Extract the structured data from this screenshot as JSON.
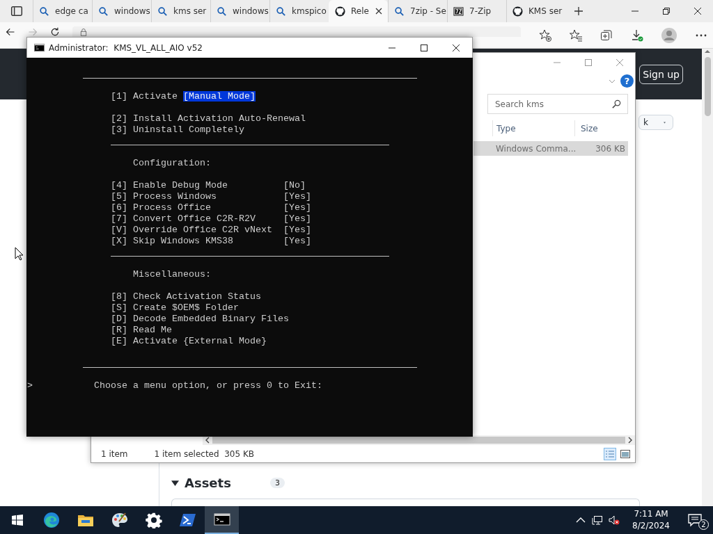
{
  "browser": {
    "tabs": [
      {
        "title": "edge ca",
        "kind": "search",
        "selected": false
      },
      {
        "title": "windows",
        "kind": "search",
        "selected": false
      },
      {
        "title": "kms ser",
        "kind": "search",
        "selected": false
      },
      {
        "title": "windows",
        "kind": "search",
        "selected": false
      },
      {
        "title": "kmspico",
        "kind": "search",
        "selected": false
      },
      {
        "title": "Rele",
        "kind": "github",
        "selected": true
      },
      {
        "title": "7zip - Se",
        "kind": "search",
        "selected": false
      },
      {
        "title": "7-Zip",
        "kind": "archive",
        "selected": false
      },
      {
        "title": "KMS ser",
        "kind": "github",
        "selected": false
      }
    ],
    "page": {
      "sign_up": "Sign up",
      "dropdown": "k",
      "assets": {
        "heading": "Assets",
        "count": "3",
        "expanded": true
      }
    }
  },
  "explorer": {
    "help": "?",
    "search": {
      "placeholder": "Search kms"
    },
    "columns": [
      "Type",
      "Size"
    ],
    "rows": [
      {
        "type": "Windows Comma...",
        "size": "306 KB",
        "selected": true
      }
    ],
    "status": {
      "items": "1 item",
      "selection": "1 item selected  305 KB"
    },
    "views": [
      {
        "kind": "details",
        "selected": true
      },
      {
        "kind": "preview",
        "selected": false
      }
    ]
  },
  "console": {
    "title": "Administrator:  KMS_VL_ALL_AIO v52",
    "lines": [
      {
        "kind": "blank"
      },
      {
        "kind": "rule"
      },
      {
        "kind": "blank"
      },
      {
        "kind": "option",
        "key": "[1]",
        "label": "Activate",
        "tag": "[Manual Mode]",
        "highlighted": true
      },
      {
        "kind": "blank"
      },
      {
        "kind": "option",
        "key": "[2]",
        "label": "Install Activation Auto-Renewal"
      },
      {
        "kind": "option",
        "key": "[3]",
        "label": "Uninstall Completely"
      },
      {
        "kind": "subrule"
      },
      {
        "kind": "blank"
      },
      {
        "kind": "heading",
        "text": "Configuration:"
      },
      {
        "kind": "blank"
      },
      {
        "kind": "option",
        "key": "[4]",
        "label": "Enable Debug Mode",
        "value": "[No]"
      },
      {
        "kind": "option",
        "key": "[5]",
        "label": "Process Windows",
        "value": "[Yes]"
      },
      {
        "kind": "option",
        "key": "[6]",
        "label": "Process Office",
        "value": "[Yes]"
      },
      {
        "kind": "option",
        "key": "[7]",
        "label": "Convert Office C2R-R2V",
        "value": "[Yes]"
      },
      {
        "kind": "option",
        "key": "[V]",
        "label": "Override Office C2R vNext",
        "value": "[Yes]"
      },
      {
        "kind": "option",
        "key": "[X]",
        "label": "Skip Windows KMS38",
        "value": "[Yes]"
      },
      {
        "kind": "subrule"
      },
      {
        "kind": "blank"
      },
      {
        "kind": "heading",
        "text": "Miscellaneous:"
      },
      {
        "kind": "blank"
      },
      {
        "kind": "option",
        "key": "[8]",
        "label": "Check Activation Status"
      },
      {
        "kind": "option",
        "key": "[S]",
        "label": "Create $OEM$ Folder"
      },
      {
        "kind": "option",
        "key": "[D]",
        "label": "Decode Embedded Binary Files"
      },
      {
        "kind": "option",
        "key": "[R]",
        "label": "Read Me"
      },
      {
        "kind": "option",
        "key": "[E]",
        "label": "Activate",
        "tag": "{External Mode}",
        "highlighted": false
      },
      {
        "kind": "blank"
      },
      {
        "kind": "rule"
      },
      {
        "kind": "blank"
      },
      {
        "kind": "prompt",
        "caret": ">",
        "text": "Choose a menu option, or press 0 to Exit:"
      }
    ]
  },
  "taskbar": {
    "apps": [
      {
        "kind": "browser",
        "selected": false
      },
      {
        "kind": "folder",
        "selected": false
      },
      {
        "kind": "paint",
        "selected": false
      },
      {
        "kind": "settings",
        "selected": false
      },
      {
        "kind": "powershell",
        "selected": false
      },
      {
        "kind": "terminal",
        "selected": true
      }
    ],
    "clock": {
      "time": "7:11 AM",
      "date": "8/2/2024"
    },
    "notifications": "2"
  }
}
